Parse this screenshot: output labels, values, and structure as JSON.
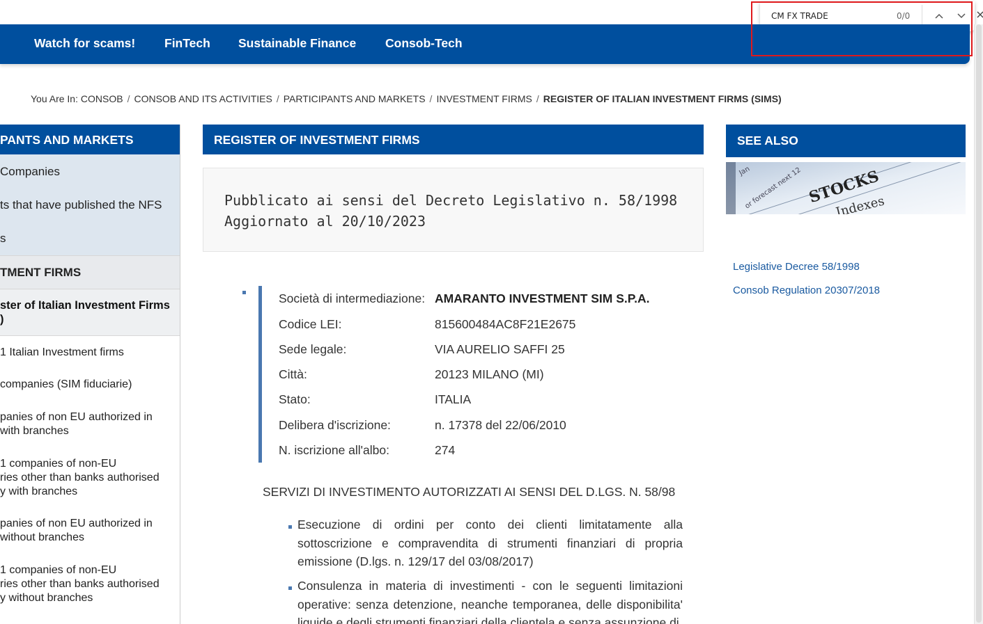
{
  "find_bar": {
    "query": "CM FX TRADE",
    "match_count": "0/0",
    "prev_icon": "chevron-up-icon",
    "next_icon": "chevron-down-icon",
    "close_icon": "close-icon",
    "highlight_color": "#e0191c"
  },
  "top_nav": {
    "items": [
      "Watch for scams!",
      "FinTech",
      "Sustainable Finance",
      "Consob-Tech"
    ],
    "color": "#004f9e"
  },
  "breadcrumb": {
    "prefix": "You Are In:",
    "items": [
      "CONSOB",
      "CONSOB AND ITS ACTIVITIES",
      "PARTICIPANTS AND MARKETS",
      "INVESTMENT FIRMS"
    ],
    "current": "REGISTER OF ITALIAN INVESTMENT FIRMS (SIMS)"
  },
  "sidebar": {
    "title": "PANTS AND MARKETS",
    "sub_items": [
      "Companies",
      "ts that have published the NFS",
      "s"
    ],
    "section": "TMENT FIRMS",
    "active_line1": "ster of Italian Investment Firms",
    "active_line2": ")",
    "list": [
      "1 Italian Investment firms",
      "companies (SIM fiduciarie)",
      "panies of non EU authorized in",
      "with branches",
      "1 companies of non-EU",
      "ries other than banks authorised",
      "y with branches",
      "panies of non EU authorized in",
      "without branches",
      "1 companies of non-EU",
      "ries other than banks authorised",
      "y without branches"
    ]
  },
  "main": {
    "title": "REGISTER OF INVESTMENT FIRMS",
    "published": "Pubblicato ai sensi del Decreto Legislativo n. 58/1998",
    "updated": "Aggiornato al 20/10/2023",
    "firm": [
      {
        "label": "Società di intermediazione:",
        "value": "AMARANTO INVESTMENT SIM S.P.A."
      },
      {
        "label": "Codice LEI:",
        "value": "815600484AC8F21E2675"
      },
      {
        "label": "Sede legale:",
        "value": "VIA AURELIO SAFFI 25"
      },
      {
        "label": "Città:",
        "value": "20123  MILANO (MI)"
      },
      {
        "label": "Stato:",
        "value": "ITALIA"
      },
      {
        "label": "Delibera d'iscrizione:",
        "value": "n. 17378 del 22/06/2010"
      },
      {
        "label": "N. iscrizione all'albo:",
        "value": "274"
      }
    ],
    "services_title": "SERVIZI DI INVESTIMENTO AUTORIZZATI AI SENSI DEL D.LGS. N. 58/98",
    "services": [
      "Esecuzione di ordini per conto dei clienti limitatamente alla sottoscrizione e compravendita di strumenti finanziari di propria emissione (D.lgs. n. 129/17 del 03/08/2017)",
      "Consulenza in materia di investimenti - con le seguenti limitazioni operative: senza detenzione, neanche temporanea, delle disponibilita' liquide e degli strumenti finanziari della clientela e senza assunzione di"
    ]
  },
  "see_also": {
    "title": "SEE ALSO",
    "links": [
      "Legislative Decree 58/1998",
      "Consob Regulation 20307/2018"
    ]
  }
}
